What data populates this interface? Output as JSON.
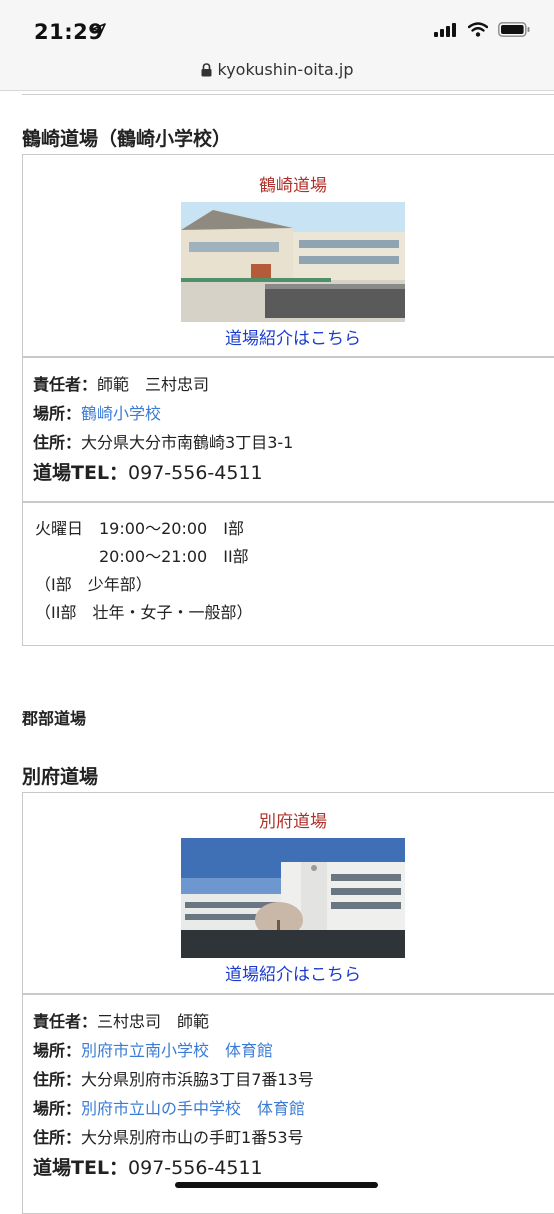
{
  "status_bar": {
    "time": "21:29",
    "icons": [
      "location-arrow-icon",
      "signal-icon",
      "wifi-icon",
      "battery-icon"
    ]
  },
  "url_bar": {
    "domain": "kyokushin-oita.jp"
  },
  "tsurusaki": {
    "heading": "鶴崎道場（鶴崎小学校）",
    "card_title": "鶴崎道場",
    "intro_link": "道場紹介はこちら",
    "responsible_label": "責任者：",
    "responsible_value": "師範　三村忠司",
    "place_label": "場所：",
    "place_value": "鶴崎小学校",
    "address_label": "住所：",
    "address_value": "大分県大分市南鶴崎3丁目3-1",
    "tel_label": "道場TEL：",
    "tel_value": "097-556-4511",
    "schedule": [
      "火曜日　19:00～20:00　I部",
      "　　　　20:00～21:00　II部",
      "（I部　少年部）",
      "（II部　壮年・女子・一般部）"
    ]
  },
  "gunbu_heading": "郡部道場",
  "beppu": {
    "heading": "別府道場",
    "card_title": "別府道場",
    "intro_link": "道場紹介はこちら",
    "responsible_label": "責任者：",
    "responsible_value": "三村忠司　師範",
    "place1_label": "場所：",
    "place1_value": "別府市立南小学校　体育館",
    "address1_label": "住所：",
    "address1_value": "大分県別府市浜脇3丁目7番13号",
    "place2_label": "場所：",
    "place2_value": "別府市立山の手中学校　体育館",
    "address2_label": "住所：",
    "address2_value": "大分県別府市山の手町1番53号",
    "tel_label": "道場TEL：",
    "tel_value": "097-556-4511"
  }
}
